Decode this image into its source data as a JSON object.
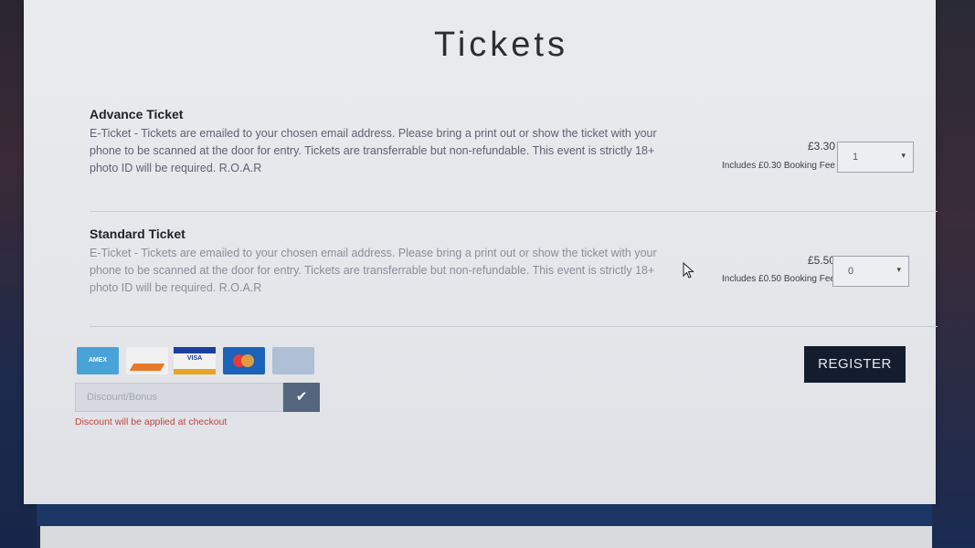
{
  "page": {
    "title": "Tickets"
  },
  "tickets": [
    {
      "name": "Advance Ticket",
      "description": "E-Ticket - Tickets are emailed to your chosen email address. Please bring a print out or show the ticket with your phone to be scanned at the door for entry. Tickets are transferrable but non-refundable. This event is strictly 18+ photo ID will be required. R.O.A.R",
      "price": "£3.30",
      "fee_note": "Includes £0.30 Booking Fee",
      "quantity": "1"
    },
    {
      "name": "Standard Ticket",
      "description": "E-Ticket - Tickets are emailed to your chosen email address. Please bring a print out or show the ticket with your phone to be scanned at the door for entry. Tickets are transferrable but non-refundable. This event is strictly 18+ photo ID will be required. R.O.A.R",
      "price": "£5.50",
      "fee_note": "Includes £0.50 Booking Fee",
      "quantity": "0"
    }
  ],
  "payment_cards": [
    {
      "icon": "amex-card-icon",
      "label": "AMEX"
    },
    {
      "icon": "maestro-card-icon",
      "label": ""
    },
    {
      "icon": "visa-card-icon",
      "label": "VISA"
    },
    {
      "icon": "mastercard-card-icon",
      "label": ""
    },
    {
      "icon": "generic-card-icon",
      "label": ""
    }
  ],
  "discount": {
    "placeholder": "Discount/Bonus",
    "apply_icon": "check-icon",
    "apply_glyph": "✔",
    "note": "Discount will be applied at checkout"
  },
  "actions": {
    "register_label": "REGISTER"
  },
  "colors": {
    "register_bg": "#141d2e",
    "discount_note": "#c0443f",
    "page_bg": "#1d2a44"
  }
}
